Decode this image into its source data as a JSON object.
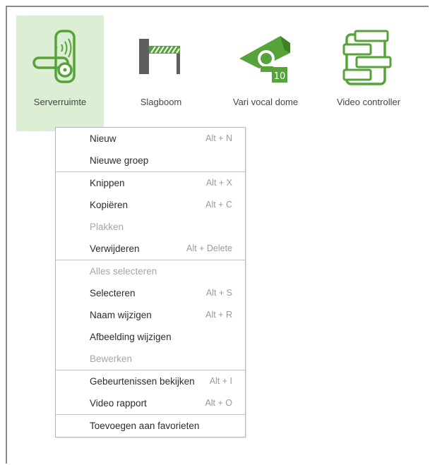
{
  "tiles": [
    {
      "label": "Serverruimte",
      "icon": "door-lock-icon",
      "selected": true
    },
    {
      "label": "Slagboom",
      "icon": "barrier-gate-icon",
      "selected": false
    },
    {
      "label": "Vari vocal dome",
      "icon": "camera-dome-icon",
      "badge": "10",
      "selected": false
    },
    {
      "label": "Video controller",
      "icon": "video-controller-icon",
      "selected": false
    }
  ],
  "colors": {
    "accent": "#56a33a",
    "selected_bg": "#dceed4",
    "accent_dark": "#3f7f28"
  },
  "context_menu": {
    "groups": [
      [
        {
          "label": "Nieuw",
          "shortcut": "Alt + N",
          "enabled": true
        },
        {
          "label": "Nieuwe groep",
          "shortcut": "",
          "enabled": true
        }
      ],
      [
        {
          "label": "Knippen",
          "shortcut": "Alt + X",
          "enabled": true
        },
        {
          "label": "Kopiëren",
          "shortcut": "Alt + C",
          "enabled": true
        },
        {
          "label": "Plakken",
          "shortcut": "",
          "enabled": false
        },
        {
          "label": "Verwijderen",
          "shortcut": "Alt + Delete",
          "enabled": true
        }
      ],
      [
        {
          "label": "Alles selecteren",
          "shortcut": "",
          "enabled": false
        },
        {
          "label": "Selecteren",
          "shortcut": "Alt + S",
          "enabled": true
        },
        {
          "label": "Naam wijzigen",
          "shortcut": "Alt + R",
          "enabled": true
        },
        {
          "label": "Afbeelding wijzigen",
          "shortcut": "",
          "enabled": true
        },
        {
          "label": "Bewerken",
          "shortcut": "",
          "enabled": false
        }
      ],
      [
        {
          "label": "Gebeurtenissen bekijken",
          "shortcut": "Alt + I",
          "enabled": true
        },
        {
          "label": "Video rapport",
          "shortcut": "Alt + O",
          "enabled": true
        }
      ],
      [
        {
          "label": "Toevoegen aan favorieten",
          "shortcut": "",
          "enabled": true
        }
      ]
    ]
  }
}
